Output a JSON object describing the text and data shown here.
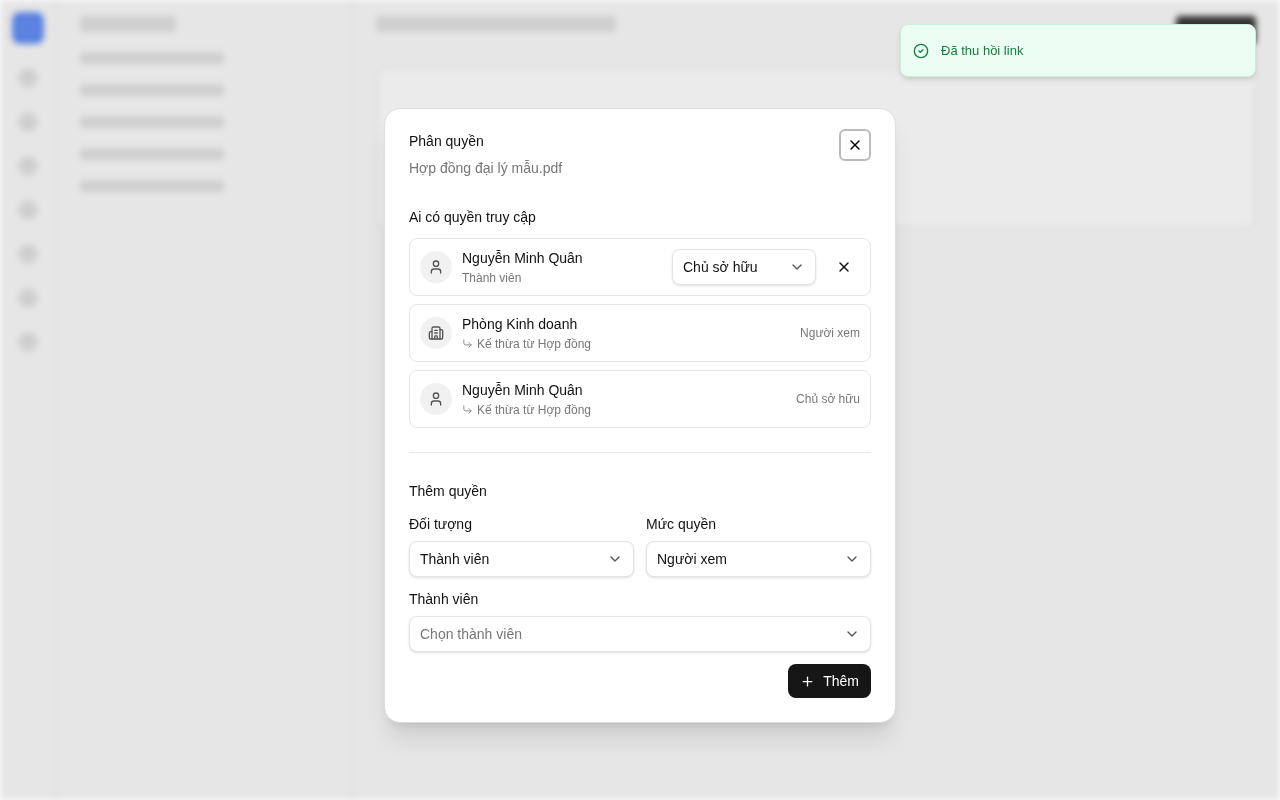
{
  "toast": {
    "message": "Đã thu hồi link"
  },
  "dialog": {
    "title": "Phân quyền",
    "subtitle": "Hợp đồng đại lý mẫu.pdf",
    "access_heading": "Ai có quyền truy cập",
    "entries": [
      {
        "kind": "editable",
        "group": false,
        "name": "Nguyễn Minh Quân",
        "detail": "Thành viên",
        "inherited": false,
        "role": "Chủ sở hữu"
      },
      {
        "kind": "readonly",
        "group": true,
        "name": "Phòng Kinh doanh",
        "detail": "Kế thừa từ Hợp đồng",
        "inherited": true,
        "role": "Người xem"
      },
      {
        "kind": "readonly",
        "group": false,
        "name": "Nguyễn Minh Quân",
        "detail": "Kế thừa từ Hợp đồng",
        "inherited": true,
        "role": "Chủ sở hữu"
      }
    ],
    "add": {
      "heading": "Thêm quyền",
      "subject_label": "Đối tượng",
      "subject_value": "Thành viên",
      "level_label": "Mức quyền",
      "level_value": "Người xem",
      "member_label": "Thành viên",
      "member_placeholder": "Chọn thành viên",
      "button": "Thêm"
    }
  }
}
